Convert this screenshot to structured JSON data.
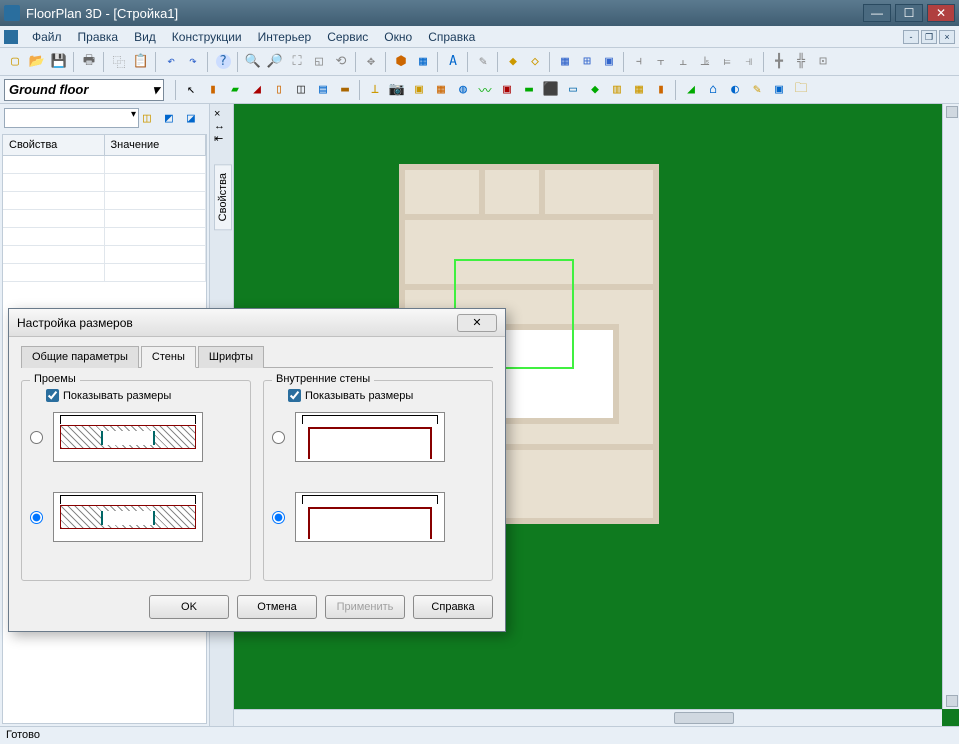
{
  "app": {
    "title": "FloorPlan 3D - [Стройка1]"
  },
  "menu": {
    "items": [
      "Файл",
      "Правка",
      "Вид",
      "Конструкции",
      "Интерьер",
      "Сервис",
      "Окно",
      "Справка"
    ]
  },
  "toolbar1_icons": [
    "new",
    "open",
    "save",
    "print",
    "copy",
    "paste",
    "undo",
    "redo",
    "help",
    "zoom-in",
    "zoom-out",
    "zoom-fit",
    "zoom-window",
    "zoom-prev",
    "pan",
    "measure",
    "3d",
    "plan",
    "text",
    "layer",
    "color1",
    "color2",
    "grid",
    "snap",
    "render",
    "align-l",
    "align-c",
    "align-r",
    "align-t",
    "align-m",
    "align-b",
    "dist-h",
    "dist-v",
    "group"
  ],
  "toolbar2": {
    "floor_label": "Ground floor",
    "icons": [
      "pointer",
      "wall",
      "slab",
      "roof",
      "door",
      "window",
      "stairs",
      "column",
      "beam",
      "cam",
      "light",
      "ob1",
      "ob2",
      "ob3",
      "ob4",
      "furn",
      "tree",
      "road",
      "text2",
      "car",
      "fence",
      "hedge",
      "rail",
      "paint",
      "house",
      "world",
      "pencil",
      "element",
      "folder"
    ]
  },
  "side": {
    "col1": "Свойства",
    "col2": "Значение",
    "vtab": "Свойства"
  },
  "dialog": {
    "title": "Настройка размеров",
    "tabs": [
      "Общие параметры",
      "Стены",
      "Шрифты"
    ],
    "active_tab": 1,
    "group1_title": "Проемы",
    "group2_title": "Внутренние стены",
    "checkbox_label": "Показывать размеры",
    "checkbox1_checked": true,
    "checkbox2_checked": true,
    "buttons": {
      "ok": "OK",
      "cancel": "Отмена",
      "apply": "Применить",
      "help": "Справка"
    }
  },
  "status": {
    "text": "Готово"
  }
}
